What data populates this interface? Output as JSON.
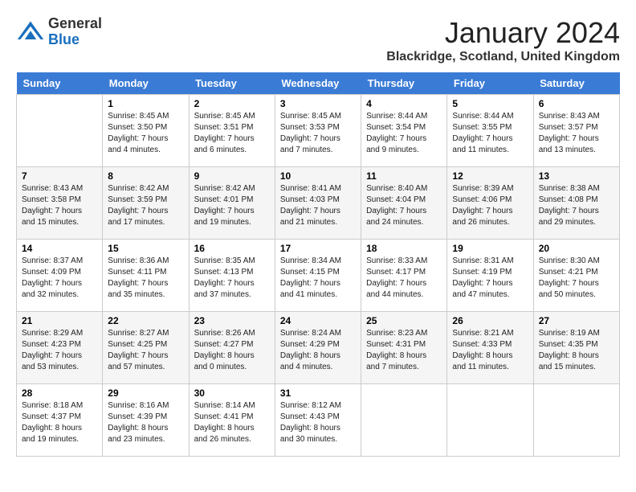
{
  "header": {
    "logo_general": "General",
    "logo_blue": "Blue",
    "month_title": "January 2024",
    "location": "Blackridge, Scotland, United Kingdom"
  },
  "days_of_week": [
    "Sunday",
    "Monday",
    "Tuesday",
    "Wednesday",
    "Thursday",
    "Friday",
    "Saturday"
  ],
  "weeks": [
    [
      {
        "day": "",
        "sunrise": "",
        "sunset": "",
        "daylight": ""
      },
      {
        "day": "1",
        "sunrise": "Sunrise: 8:45 AM",
        "sunset": "Sunset: 3:50 PM",
        "daylight": "Daylight: 7 hours and 4 minutes."
      },
      {
        "day": "2",
        "sunrise": "Sunrise: 8:45 AM",
        "sunset": "Sunset: 3:51 PM",
        "daylight": "Daylight: 7 hours and 6 minutes."
      },
      {
        "day": "3",
        "sunrise": "Sunrise: 8:45 AM",
        "sunset": "Sunset: 3:53 PM",
        "daylight": "Daylight: 7 hours and 7 minutes."
      },
      {
        "day": "4",
        "sunrise": "Sunrise: 8:44 AM",
        "sunset": "Sunset: 3:54 PM",
        "daylight": "Daylight: 7 hours and 9 minutes."
      },
      {
        "day": "5",
        "sunrise": "Sunrise: 8:44 AM",
        "sunset": "Sunset: 3:55 PM",
        "daylight": "Daylight: 7 hours and 11 minutes."
      },
      {
        "day": "6",
        "sunrise": "Sunrise: 8:43 AM",
        "sunset": "Sunset: 3:57 PM",
        "daylight": "Daylight: 7 hours and 13 minutes."
      }
    ],
    [
      {
        "day": "7",
        "sunrise": "Sunrise: 8:43 AM",
        "sunset": "Sunset: 3:58 PM",
        "daylight": "Daylight: 7 hours and 15 minutes."
      },
      {
        "day": "8",
        "sunrise": "Sunrise: 8:42 AM",
        "sunset": "Sunset: 3:59 PM",
        "daylight": "Daylight: 7 hours and 17 minutes."
      },
      {
        "day": "9",
        "sunrise": "Sunrise: 8:42 AM",
        "sunset": "Sunset: 4:01 PM",
        "daylight": "Daylight: 7 hours and 19 minutes."
      },
      {
        "day": "10",
        "sunrise": "Sunrise: 8:41 AM",
        "sunset": "Sunset: 4:03 PM",
        "daylight": "Daylight: 7 hours and 21 minutes."
      },
      {
        "day": "11",
        "sunrise": "Sunrise: 8:40 AM",
        "sunset": "Sunset: 4:04 PM",
        "daylight": "Daylight: 7 hours and 24 minutes."
      },
      {
        "day": "12",
        "sunrise": "Sunrise: 8:39 AM",
        "sunset": "Sunset: 4:06 PM",
        "daylight": "Daylight: 7 hours and 26 minutes."
      },
      {
        "day": "13",
        "sunrise": "Sunrise: 8:38 AM",
        "sunset": "Sunset: 4:08 PM",
        "daylight": "Daylight: 7 hours and 29 minutes."
      }
    ],
    [
      {
        "day": "14",
        "sunrise": "Sunrise: 8:37 AM",
        "sunset": "Sunset: 4:09 PM",
        "daylight": "Daylight: 7 hours and 32 minutes."
      },
      {
        "day": "15",
        "sunrise": "Sunrise: 8:36 AM",
        "sunset": "Sunset: 4:11 PM",
        "daylight": "Daylight: 7 hours and 35 minutes."
      },
      {
        "day": "16",
        "sunrise": "Sunrise: 8:35 AM",
        "sunset": "Sunset: 4:13 PM",
        "daylight": "Daylight: 7 hours and 37 minutes."
      },
      {
        "day": "17",
        "sunrise": "Sunrise: 8:34 AM",
        "sunset": "Sunset: 4:15 PM",
        "daylight": "Daylight: 7 hours and 41 minutes."
      },
      {
        "day": "18",
        "sunrise": "Sunrise: 8:33 AM",
        "sunset": "Sunset: 4:17 PM",
        "daylight": "Daylight: 7 hours and 44 minutes."
      },
      {
        "day": "19",
        "sunrise": "Sunrise: 8:31 AM",
        "sunset": "Sunset: 4:19 PM",
        "daylight": "Daylight: 7 hours and 47 minutes."
      },
      {
        "day": "20",
        "sunrise": "Sunrise: 8:30 AM",
        "sunset": "Sunset: 4:21 PM",
        "daylight": "Daylight: 7 hours and 50 minutes."
      }
    ],
    [
      {
        "day": "21",
        "sunrise": "Sunrise: 8:29 AM",
        "sunset": "Sunset: 4:23 PM",
        "daylight": "Daylight: 7 hours and 53 minutes."
      },
      {
        "day": "22",
        "sunrise": "Sunrise: 8:27 AM",
        "sunset": "Sunset: 4:25 PM",
        "daylight": "Daylight: 7 hours and 57 minutes."
      },
      {
        "day": "23",
        "sunrise": "Sunrise: 8:26 AM",
        "sunset": "Sunset: 4:27 PM",
        "daylight": "Daylight: 8 hours and 0 minutes."
      },
      {
        "day": "24",
        "sunrise": "Sunrise: 8:24 AM",
        "sunset": "Sunset: 4:29 PM",
        "daylight": "Daylight: 8 hours and 4 minutes."
      },
      {
        "day": "25",
        "sunrise": "Sunrise: 8:23 AM",
        "sunset": "Sunset: 4:31 PM",
        "daylight": "Daylight: 8 hours and 7 minutes."
      },
      {
        "day": "26",
        "sunrise": "Sunrise: 8:21 AM",
        "sunset": "Sunset: 4:33 PM",
        "daylight": "Daylight: 8 hours and 11 minutes."
      },
      {
        "day": "27",
        "sunrise": "Sunrise: 8:19 AM",
        "sunset": "Sunset: 4:35 PM",
        "daylight": "Daylight: 8 hours and 15 minutes."
      }
    ],
    [
      {
        "day": "28",
        "sunrise": "Sunrise: 8:18 AM",
        "sunset": "Sunset: 4:37 PM",
        "daylight": "Daylight: 8 hours and 19 minutes."
      },
      {
        "day": "29",
        "sunrise": "Sunrise: 8:16 AM",
        "sunset": "Sunset: 4:39 PM",
        "daylight": "Daylight: 8 hours and 23 minutes."
      },
      {
        "day": "30",
        "sunrise": "Sunrise: 8:14 AM",
        "sunset": "Sunset: 4:41 PM",
        "daylight": "Daylight: 8 hours and 26 minutes."
      },
      {
        "day": "31",
        "sunrise": "Sunrise: 8:12 AM",
        "sunset": "Sunset: 4:43 PM",
        "daylight": "Daylight: 8 hours and 30 minutes."
      },
      {
        "day": "",
        "sunrise": "",
        "sunset": "",
        "daylight": ""
      },
      {
        "day": "",
        "sunrise": "",
        "sunset": "",
        "daylight": ""
      },
      {
        "day": "",
        "sunrise": "",
        "sunset": "",
        "daylight": ""
      }
    ]
  ]
}
